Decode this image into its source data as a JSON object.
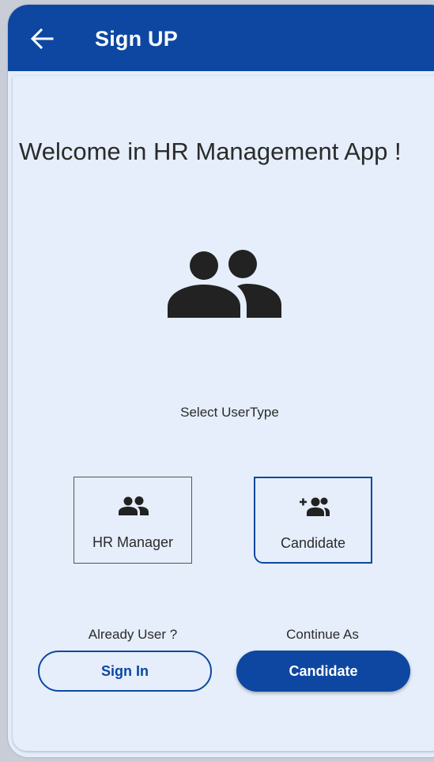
{
  "appbar": {
    "title": "Sign UP",
    "back_icon": "arrow-left-icon"
  },
  "welcome": {
    "text": "Welcome in HR Management App !"
  },
  "hero": {
    "icon": "people-icon"
  },
  "select": {
    "label": "Select UserType"
  },
  "user_types": [
    {
      "label": "HR Manager",
      "icon": "people-icon",
      "selected": false
    },
    {
      "label": "Candidate",
      "icon": "group-add-icon",
      "selected": true
    }
  ],
  "footer": {
    "left_label": "Already User ?",
    "left_button": "Sign In",
    "right_label": "Continue As",
    "right_button": "Candidate"
  },
  "colors": {
    "primary": "#0d47a1",
    "background": "#e5eefa",
    "text": "#2b2b2b"
  }
}
